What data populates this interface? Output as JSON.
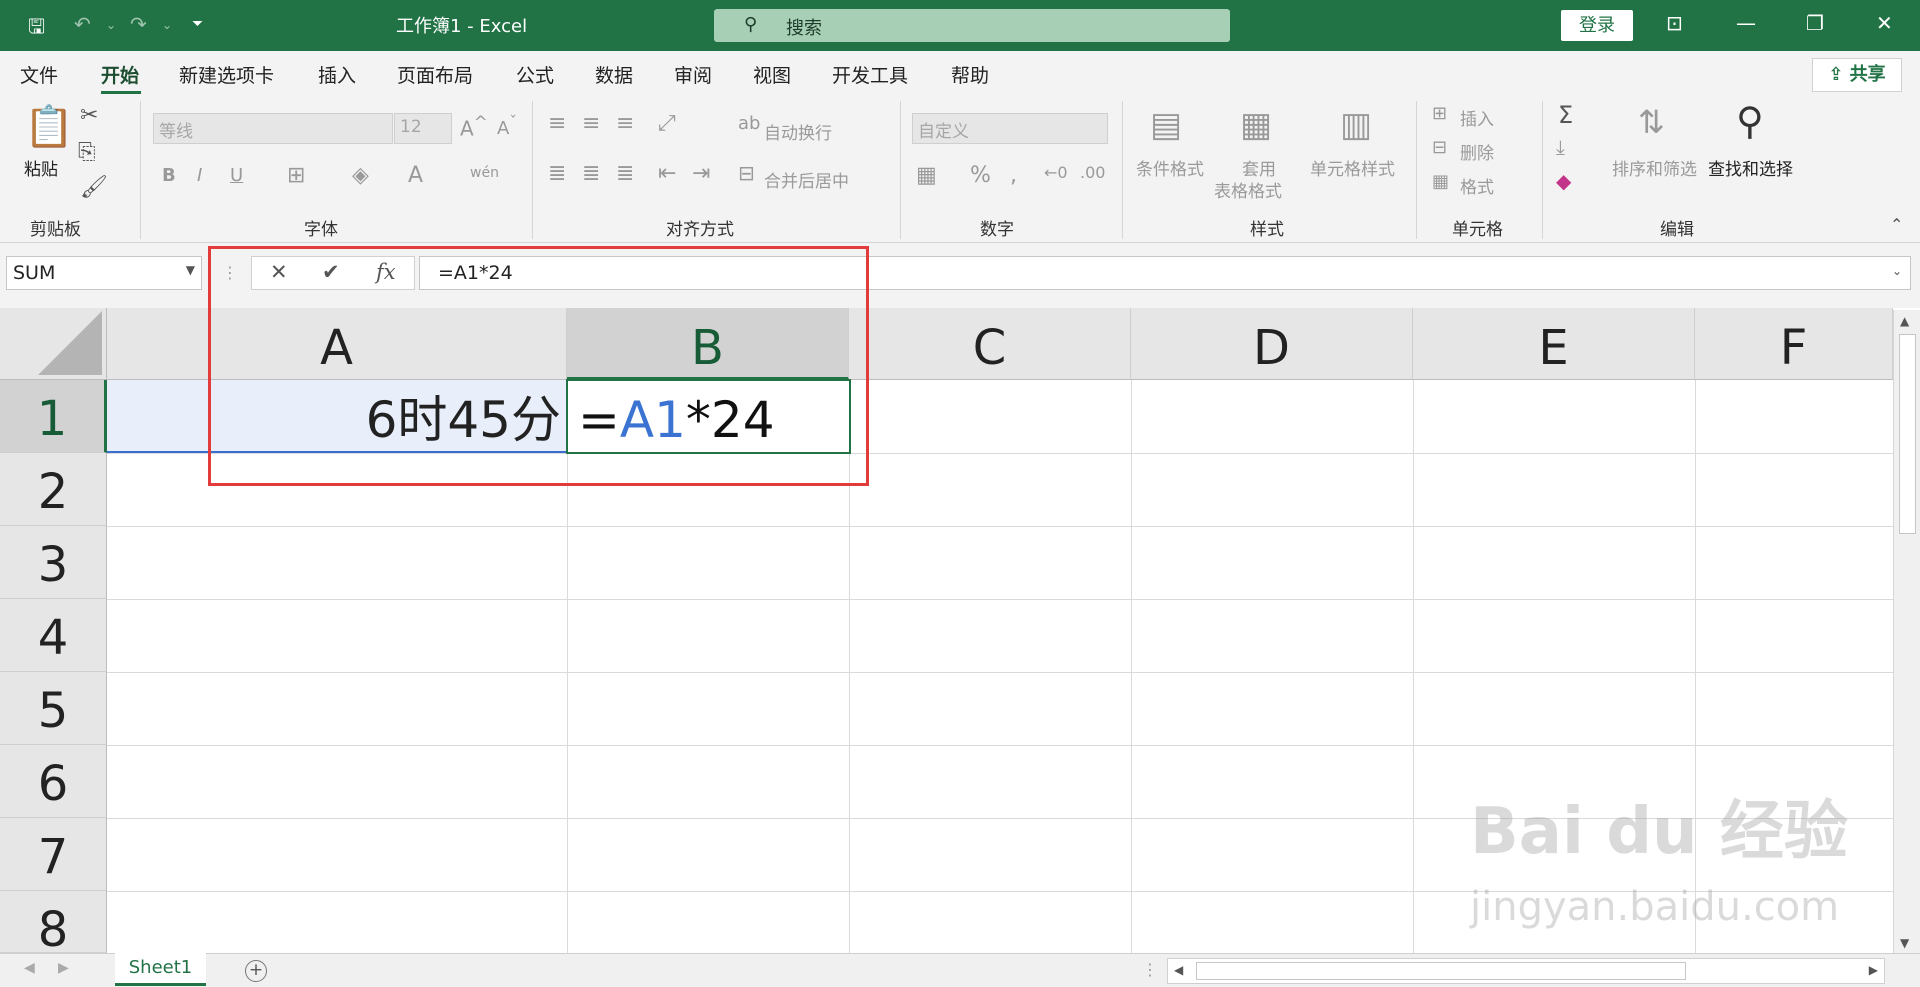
{
  "titlebar": {
    "title": "工作簿1 - Excel",
    "search_placeholder": "搜索",
    "login_label": "登录"
  },
  "menubar": {
    "items": [
      "文件",
      "开始",
      "新建选项卡",
      "插入",
      "页面布局",
      "公式",
      "数据",
      "审阅",
      "视图",
      "开发工具",
      "帮助"
    ],
    "active": "开始",
    "share_label": "共享"
  },
  "ribbon": {
    "clipboard": {
      "paste_label": "粘贴",
      "group_label": "剪贴板"
    },
    "font": {
      "font_name": "等线",
      "font_size": "12",
      "group_label": "字体"
    },
    "alignment": {
      "wrap_label": "自动换行",
      "merge_label": "合并后居中",
      "group_label": "对齐方式"
    },
    "number": {
      "format": "自定义",
      "group_label": "数字"
    },
    "styles": {
      "conditional_label": "条件格式",
      "table_label_1": "套用",
      "table_label_2": "表格格式",
      "cell_styles_label": "单元格样式",
      "group_label": "样式"
    },
    "cells": {
      "insert_label": "插入",
      "delete_label": "删除",
      "format_label": "格式",
      "group_label": "单元格"
    },
    "editing": {
      "sort_label": "排序和筛选",
      "find_label": "查找和选择",
      "group_label": "编辑"
    }
  },
  "formula_bar": {
    "name_box": "SUM",
    "formula": "=A1*24"
  },
  "grid": {
    "columns": [
      "A",
      "B",
      "C",
      "D",
      "E",
      "F"
    ],
    "rows": [
      "1",
      "2",
      "3",
      "4",
      "5",
      "6",
      "7",
      "8"
    ],
    "selected_column": "B",
    "selected_row": "1",
    "cell_A1": "6时45分",
    "cell_B1_prefix": "=",
    "cell_B1_ref": "A1",
    "cell_B1_suffix": "*24"
  },
  "sheets": {
    "tabs": [
      "Sheet1"
    ],
    "active": "Sheet1"
  },
  "watermark": {
    "line1": "Bai du 经验",
    "line2": "jingyan.baidu.com"
  },
  "colors": {
    "excel_green": "#217346",
    "highlight_red": "#e23b3b",
    "ref_blue": "#3a73d1"
  }
}
